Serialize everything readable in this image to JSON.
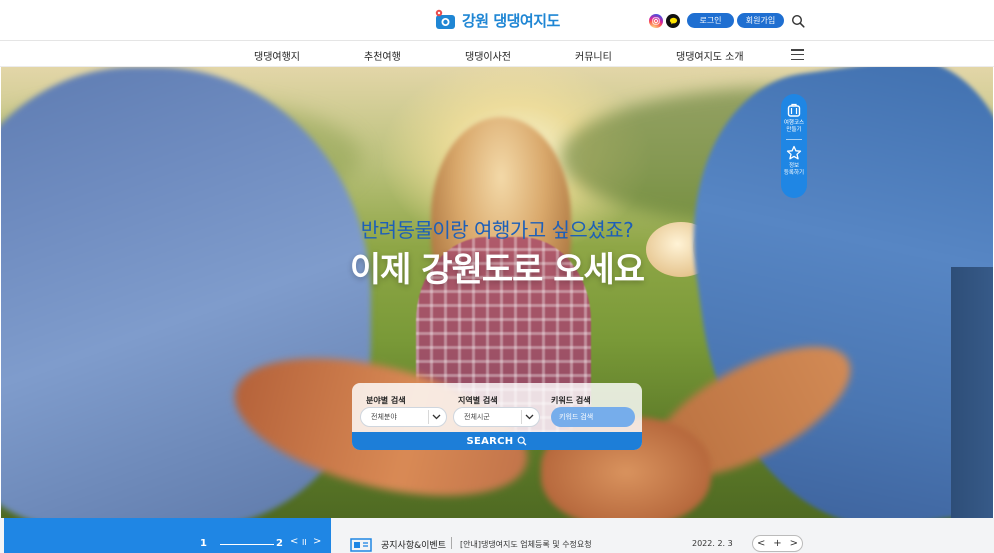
{
  "header": {
    "logo_text": "강원 댕댕여지도",
    "login_label": "로그인",
    "signup_label": "회원가입"
  },
  "nav": {
    "items": [
      "댕댕여행지",
      "추천여행",
      "댕댕이사전",
      "커뮤니티",
      "댕댕여지도 소개"
    ]
  },
  "hero": {
    "subtitle": "반려동물이랑 여행가고 싶으셨죠?",
    "title": "이제 강원도로 오세요"
  },
  "floating": {
    "items": [
      {
        "label": "여행코스\n만들기",
        "icon": "suitcase-icon"
      },
      {
        "label": "정보\n등록하기",
        "icon": "star-icon"
      }
    ]
  },
  "search": {
    "field_label": "분야별 검색",
    "field_value": "전체분야",
    "region_label": "지역별 검색",
    "region_value": "전체시군",
    "keyword_label": "키워드 검색",
    "keyword_placeholder": "키워드 검색",
    "submit_label": "SEARCH"
  },
  "bottom": {
    "slide_current": "1",
    "slide_total": "2",
    "prev": "<",
    "pause": "II",
    "next": ">",
    "notice_title": "공지사항&이벤트",
    "notice_text": "[안내]댕댕여지도 업체등록 및 수정요청",
    "notice_date": "2022. 2. 3",
    "pager_prev": "<",
    "pager_more": "+",
    "pager_next": ">"
  },
  "colors": {
    "brand_blue": "#1f86e4",
    "button_blue": "#1f6fd1",
    "subtitle_blue": "#1d5fb8"
  }
}
